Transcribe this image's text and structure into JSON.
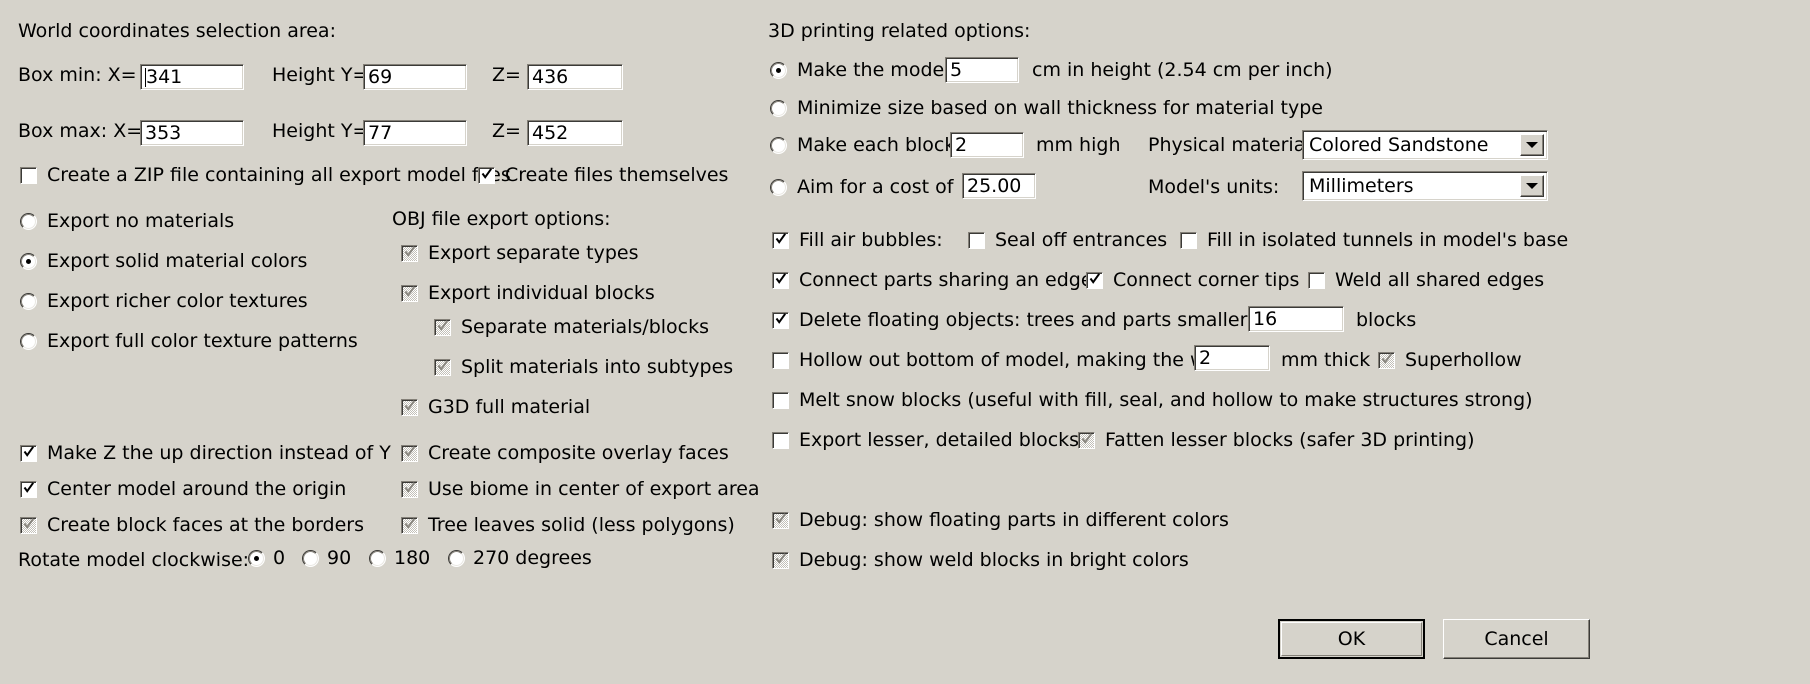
{
  "left": {
    "section_title": "World coordinates selection area:",
    "box_min": {
      "label": "Box min:  X=",
      "x_value": "341",
      "y_label": "Height Y=",
      "y_value": "69",
      "z_label": "Z=",
      "z_value": "436"
    },
    "box_max": {
      "label": "Box max: X=",
      "x_value": "353",
      "y_label": "Height Y=",
      "y_value": "77",
      "z_label": "Z=",
      "z_value": "452"
    },
    "zip_checkbox": "Create a ZIP file containing all export model files",
    "create_files_checkbox": "Create files themselves",
    "material_radios": [
      "Export no materials",
      "Export solid material colors",
      "Export richer color textures",
      "Export full color texture patterns"
    ],
    "obj_title": "OBJ file export options:",
    "obj_options": [
      "Export separate types",
      "Export individual blocks",
      "Separate materials/blocks",
      "Split materials into subtypes",
      "G3D full material",
      "Create composite overlay faces",
      "Use biome in center of export area",
      "Tree leaves solid (less polygons)"
    ],
    "bottom_options": [
      "Make Z the up direction instead of Y",
      "Center model around the origin",
      "Create block faces at the borders"
    ],
    "rotate_label": "Rotate model clockwise:",
    "rotate_options": [
      "0",
      "90",
      "180",
      "270 degrees"
    ]
  },
  "right": {
    "section_title": "3D printing related options:",
    "size_radios": {
      "make_model_pre": "Make the model",
      "make_model_value": "5",
      "make_model_post": "cm in height (2.54 cm per inch)",
      "minimize": "Minimize size based on wall thickness for material type",
      "each_block_pre": "Make each block",
      "each_block_value": "2",
      "each_block_post": "mm high",
      "cost_pre": "Aim for a cost of",
      "cost_value": "25.00"
    },
    "physical_material_label": "Physical material:",
    "physical_material_value": "Colored Sandstone",
    "units_label": "Model's units:",
    "units_value": "Millimeters",
    "fill_air_bubbles": "Fill air bubbles:",
    "seal_off_entrances": "Seal off entrances",
    "fill_isolated_tunnels": "Fill in isolated tunnels in model's base",
    "connect_parts": "Connect parts sharing an edge:",
    "connect_corner_tips": "Connect corner tips",
    "weld_shared_edges": "Weld all shared edges",
    "delete_floating_pre": "Delete floating objects: trees and parts smaller than",
    "delete_floating_value": "16",
    "delete_floating_post": "blocks",
    "hollow_pre": "Hollow out bottom of model, making the walls",
    "hollow_value": "2",
    "hollow_post": "mm thick",
    "superhollow": "Superhollow",
    "melt_snow": "Melt snow blocks (useful with fill, seal, and hollow to make structures strong)",
    "export_lesser": "Export lesser, detailed blocks:",
    "fatten_lesser": "Fatten lesser blocks (safer 3D printing)",
    "debug_floating": "Debug: show floating parts in different colors",
    "debug_weld": "Debug: show weld blocks in bright colors",
    "ok_label": "OK",
    "cancel_label": "Cancel"
  },
  "colors": {
    "dialog_bg": "#d6d3cb",
    "field_bg": "#ffffff",
    "text": "#000000",
    "disabled_mark": "#8a8780"
  }
}
